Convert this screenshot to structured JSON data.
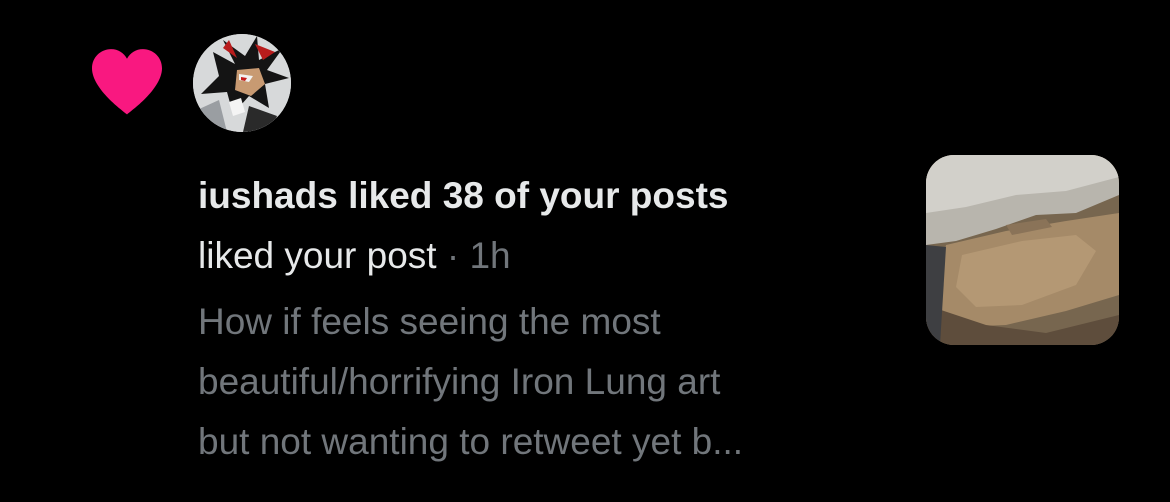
{
  "notification": {
    "type_icon": "heart-icon",
    "type_icon_color": "#f91880",
    "avatar": "user-avatar",
    "title": "iushads liked 38 of your posts",
    "action": "liked your post",
    "separator": "·",
    "time": "1h",
    "excerpt_lines": [
      "How if feels seeing the most",
      "beautiful/horrifying Iron Lung art",
      "but not wanting to retweet yet b..."
    ],
    "thumbnail": "post-media-thumbnail"
  },
  "colors": {
    "background": "#000000",
    "primary_text": "#e7e9ea",
    "secondary_text": "#71767b",
    "like_pink": "#f91880"
  }
}
